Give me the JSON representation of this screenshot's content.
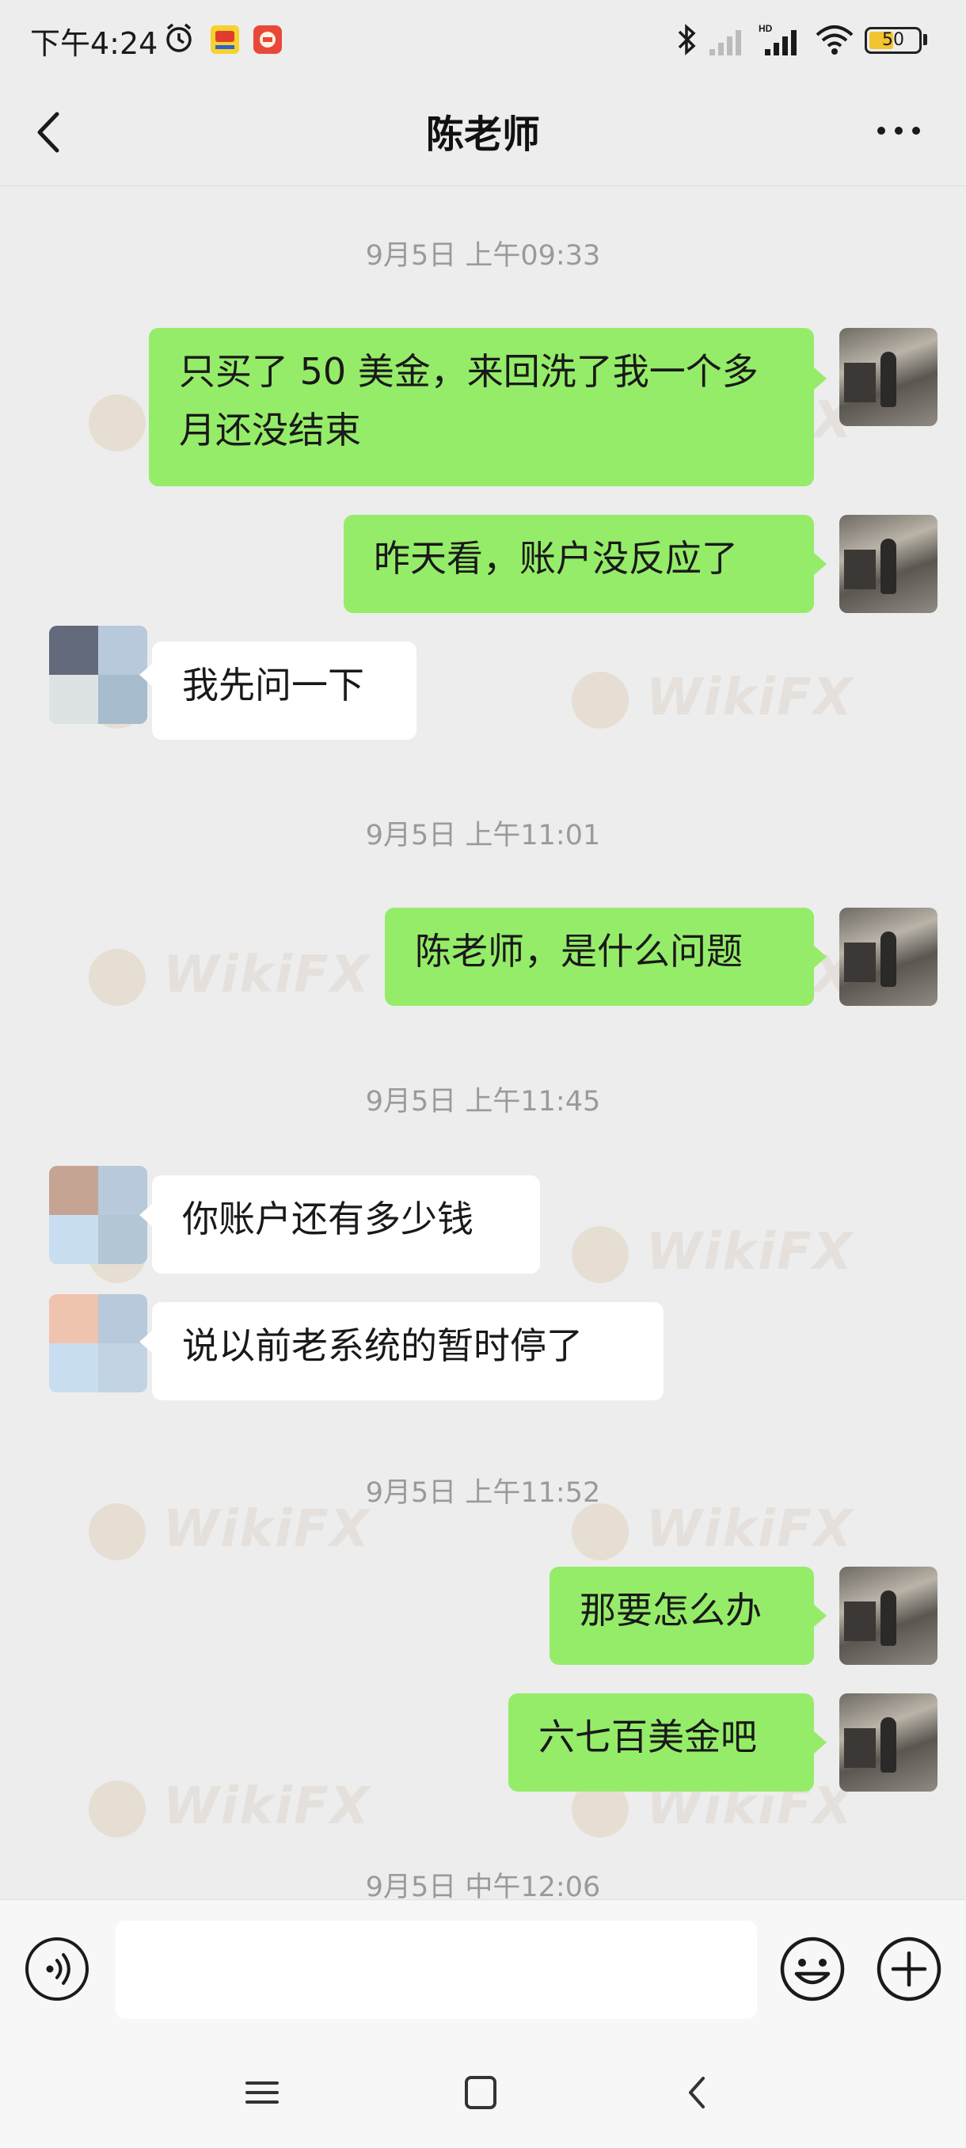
{
  "status_bar": {
    "time": "下午4:24",
    "battery": "50",
    "battery_level": 0.5,
    "icons": [
      "alarm-icon",
      "app-notification-icon",
      "app-notification-icon",
      "bluetooth-icon",
      "signal-icon",
      "hd-signal-icon",
      "wifi-icon",
      "battery-icon"
    ]
  },
  "header": {
    "title": "陈老师",
    "back_icon": "chevron-left-icon",
    "more_icon": "more-dots-icon"
  },
  "messages": [
    {
      "type": "timestamp",
      "text": "9月5日 上午09:33"
    },
    {
      "type": "msg",
      "from": "me",
      "text": "只买了 50 美金，来回洗了我一个多月还没结束"
    },
    {
      "type": "msg",
      "from": "me",
      "text": "昨天看，账户没反应了"
    },
    {
      "type": "msg",
      "from": "them",
      "text": "我先问一下"
    },
    {
      "type": "timestamp",
      "text": "9月5日 上午11:01"
    },
    {
      "type": "msg",
      "from": "me",
      "text": "陈老师，是什么问题"
    },
    {
      "type": "timestamp",
      "text": "9月5日 上午11:45"
    },
    {
      "type": "msg",
      "from": "them",
      "text": "你账户还有多少钱"
    },
    {
      "type": "msg",
      "from": "them",
      "text": "说以前老系统的暂时停了"
    },
    {
      "type": "timestamp",
      "text": "9月5日 上午11:52"
    },
    {
      "type": "msg",
      "from": "me",
      "text": "那要怎么办"
    },
    {
      "type": "msg",
      "from": "me",
      "text": "六七百美金吧"
    },
    {
      "type": "timestamp",
      "text": "9月5日 中午12:06"
    }
  ],
  "watermark": "WikiFX",
  "input_bar": {
    "value": "",
    "voice_icon": "voice-icon",
    "emoji_icon": "emoji-icon",
    "plus_icon": "plus-icon"
  },
  "nav_bar": {
    "icons": [
      "menu-icon",
      "home-icon",
      "back-icon"
    ]
  },
  "colors": {
    "background": "#ededed",
    "my_bubble": "#95ec69",
    "their_bubble": "#ffffff",
    "timestamp": "#9a9a9a"
  }
}
